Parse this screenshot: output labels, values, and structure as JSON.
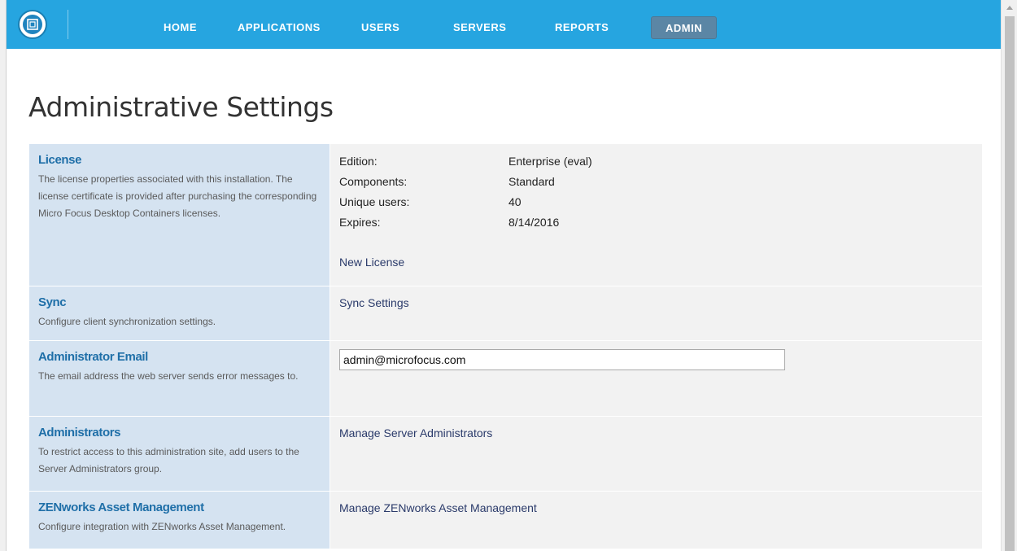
{
  "nav": {
    "items": [
      {
        "label": "HOME"
      },
      {
        "label": "APPLICATIONS"
      },
      {
        "label": "USERS"
      },
      {
        "label": "SERVERS"
      },
      {
        "label": "REPORTS"
      },
      {
        "label": "ADMIN",
        "active": true
      }
    ],
    "accent_color": "#26a5e0",
    "active_color": "#5b86a5"
  },
  "page": {
    "title": "Administrative Settings"
  },
  "settings": {
    "license": {
      "title": "License",
      "description": "The license properties associated with this installation. The license certificate is provided after purchasing the corresponding Micro Focus Desktop Containers licenses.",
      "fields": [
        {
          "label": "Edition:",
          "value": "Enterprise (eval)"
        },
        {
          "label": "Components:",
          "value": "Standard"
        },
        {
          "label": "Unique users:",
          "value": "40"
        },
        {
          "label": "Expires:",
          "value": "8/14/2016"
        }
      ],
      "link": "New License"
    },
    "sync": {
      "title": "Sync",
      "description": "Configure client synchronization settings.",
      "link": "Sync Settings"
    },
    "admin_email": {
      "title": "Administrator Email",
      "description": "The email address the web server sends error messages to.",
      "value": "admin@microfocus.com"
    },
    "administrators": {
      "title": "Administrators",
      "description": "To restrict access to this administration site, add users to the Server Administrators group.",
      "link": "Manage Server Administrators"
    },
    "zenworks": {
      "title": "ZENworks Asset Management",
      "description": "Configure integration with ZENworks Asset Management.",
      "link": "Manage ZENworks Asset Management"
    }
  }
}
